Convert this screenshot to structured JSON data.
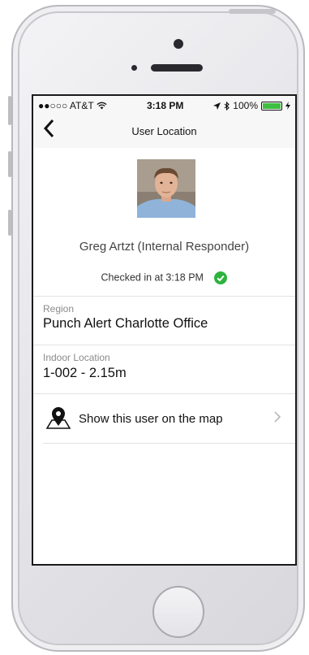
{
  "status_bar": {
    "carrier": "●●○○○ AT&T",
    "time": "3:18 PM",
    "battery": "100%",
    "battery_level": 1.0
  },
  "nav": {
    "title": "User Location"
  },
  "user": {
    "name": "Greg Artzt (Internal Responder)",
    "checked_in": "Checked in at 3:18 PM"
  },
  "region": {
    "label": "Region",
    "value": "Punch Alert Charlotte Office"
  },
  "indoor": {
    "label": "Indoor Location",
    "value": "1-002 - 2.15m"
  },
  "map_row": {
    "label": "Show this user on the map"
  },
  "colors": {
    "checkmark": "#2db33d",
    "battery": "#3fbf3f",
    "divider": "#e2e2e2"
  }
}
